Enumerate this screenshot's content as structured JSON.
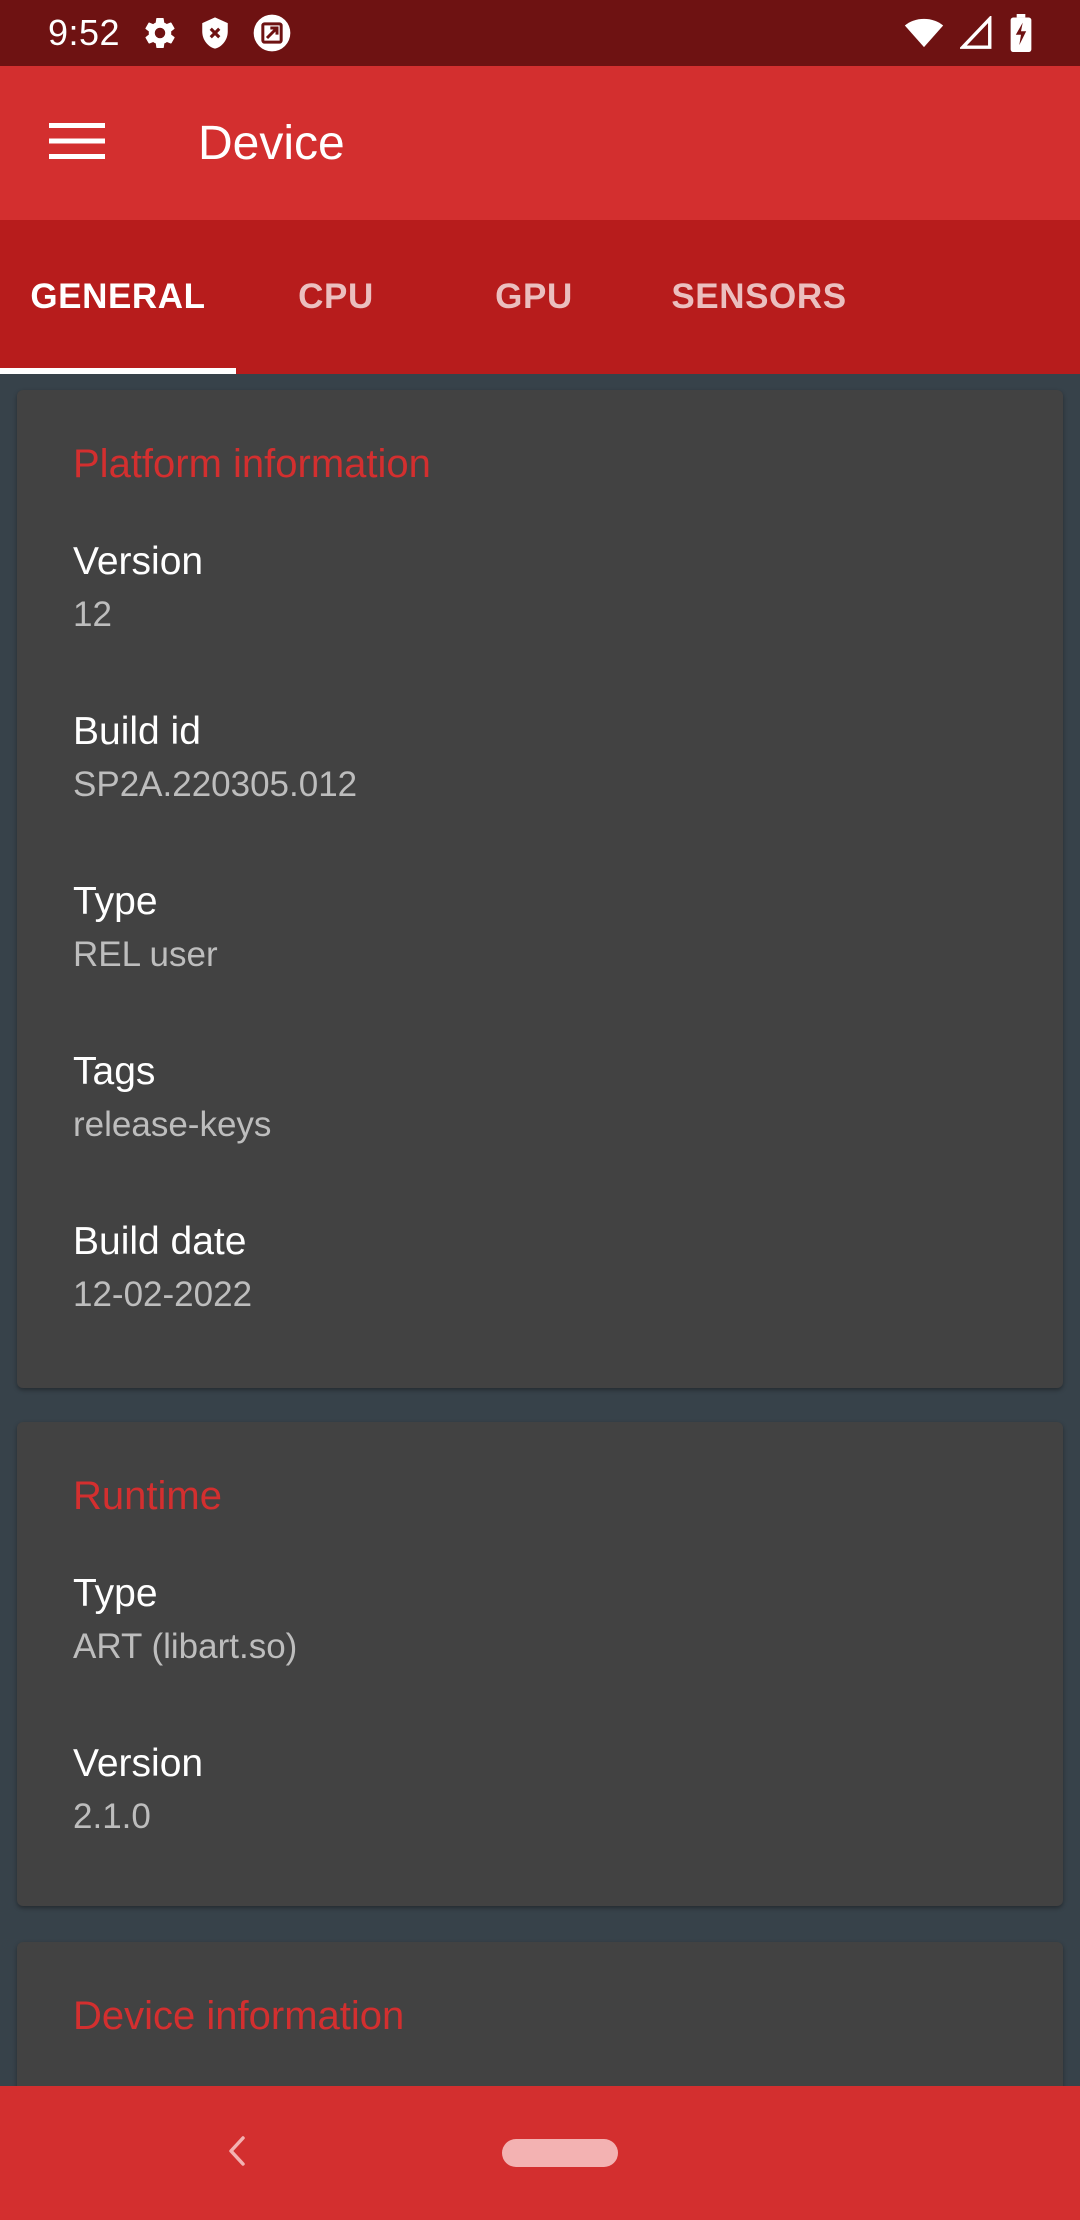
{
  "status_bar": {
    "time": "9:52",
    "left_icons": [
      "gear-icon",
      "shield-icon",
      "screen-icon"
    ],
    "right_icons": [
      "wifi-icon",
      "cell-signal-icon",
      "battery-charging-icon"
    ]
  },
  "app_bar": {
    "title": "Device",
    "menu_icon": "hamburger-menu-icon"
  },
  "tabs": [
    {
      "label": "GENERAL",
      "active": true
    },
    {
      "label": "CPU",
      "active": false
    },
    {
      "label": "GPU",
      "active": false
    },
    {
      "label": "SENSORS",
      "active": false
    }
  ],
  "cards": {
    "platform": {
      "title": "Platform information",
      "rows": [
        {
          "label": "Version",
          "value": "12"
        },
        {
          "label": "Build id",
          "value": "SP2A.220305.012"
        },
        {
          "label": "Type",
          "value": "REL user"
        },
        {
          "label": "Tags",
          "value": "release-keys"
        },
        {
          "label": "Build date",
          "value": "12-02-2022"
        }
      ]
    },
    "runtime": {
      "title": "Runtime",
      "rows": [
        {
          "label": "Type",
          "value": "ART (libart.so)"
        },
        {
          "label": "Version",
          "value": "2.1.0"
        }
      ]
    },
    "device": {
      "title": "Device information"
    }
  },
  "nav_bar": {
    "back_icon": "back-chevron-icon",
    "home_icon": "home-pill-icon"
  },
  "colors": {
    "status_bar": "#6e1212",
    "app_bar": "#d32f2f",
    "tabs": "#b71c1c",
    "background": "#37424a",
    "card": "#424242",
    "accent": "#d32f2f"
  }
}
